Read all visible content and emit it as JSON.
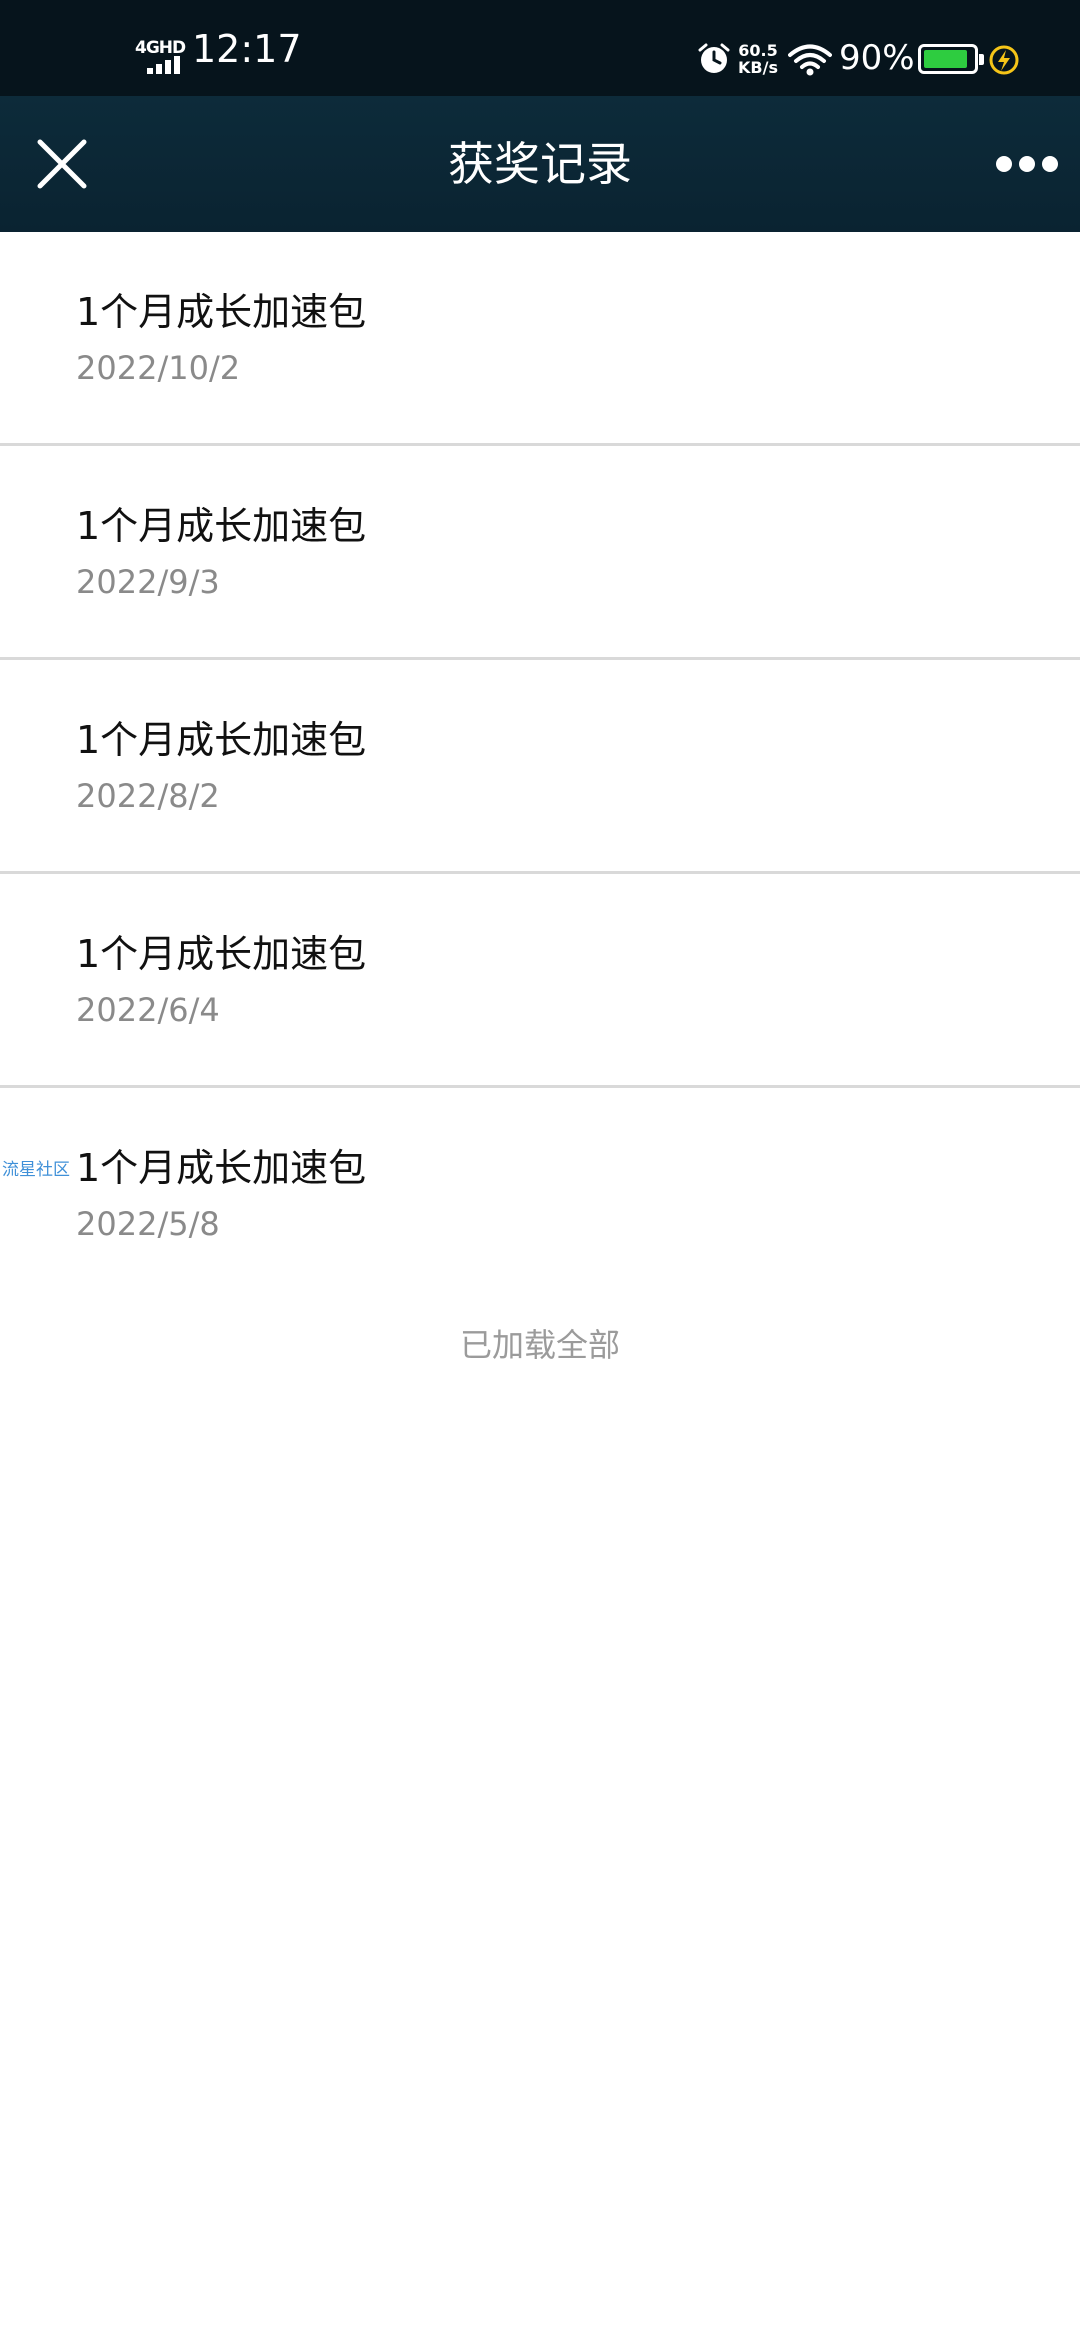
{
  "status_bar": {
    "network": "4GHD",
    "time": "12:17",
    "speed_value": "60.5",
    "speed_unit": "KB/s",
    "battery_pct": "90%",
    "battery_level": 0.9,
    "colors": {
      "background": "#06141c",
      "battery": "#2ecc40",
      "charge": "#f5c518"
    }
  },
  "nav": {
    "title": "获奖记录",
    "close_icon": "close-icon",
    "more_icon": "more-icon"
  },
  "records": [
    {
      "name": "1个月成长加速包",
      "date": "2022/10/2"
    },
    {
      "name": "1个月成长加速包",
      "date": "2022/9/3"
    },
    {
      "name": "1个月成长加速包",
      "date": "2022/8/2"
    },
    {
      "name": "1个月成长加速包",
      "date": "2022/6/4"
    },
    {
      "name": "1个月成长加速包",
      "date": "2022/5/8"
    }
  ],
  "watermark": "流星社区",
  "footer": "已加载全部"
}
